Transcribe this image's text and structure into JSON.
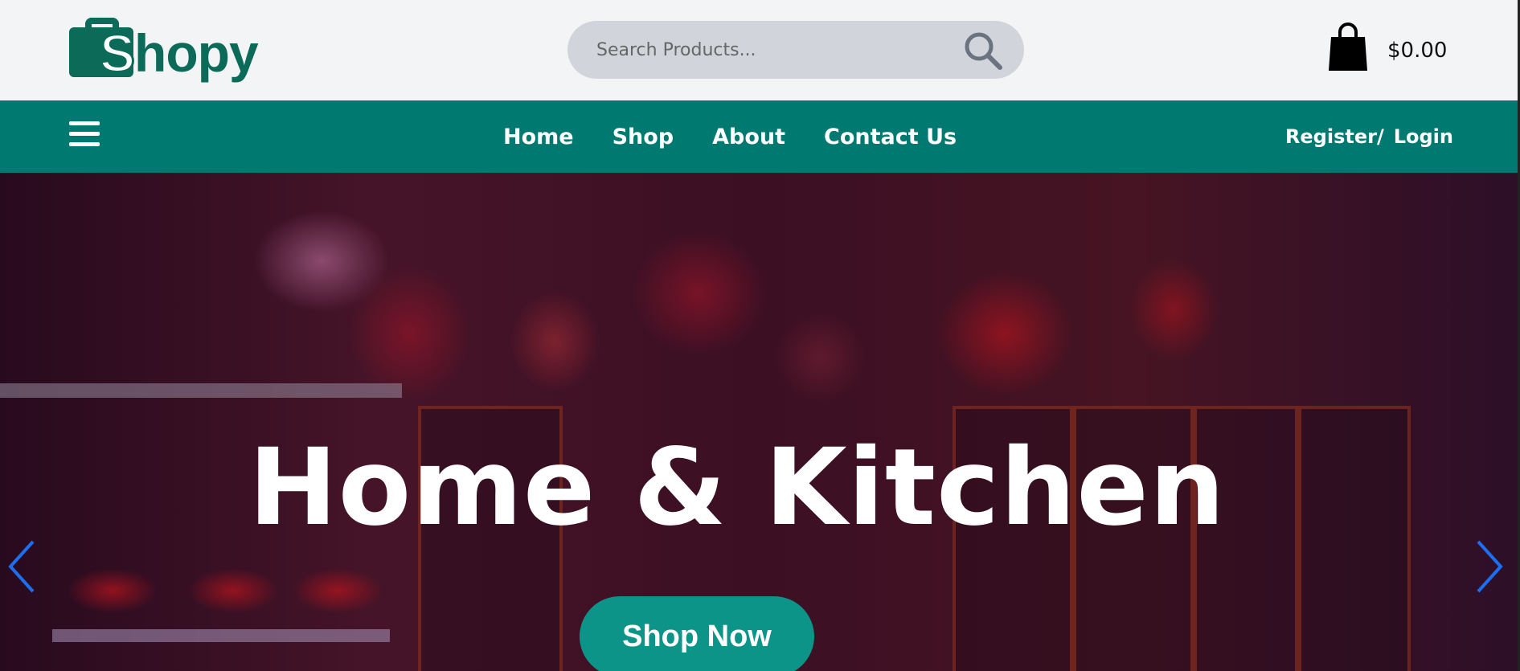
{
  "header": {
    "logo_text": "Shopy",
    "search_placeholder": "Search Products...",
    "search_icon": "search-icon",
    "cart_icon": "shopping-bag-icon",
    "cart_total": "$0.00"
  },
  "nav": {
    "menu_icon": "hamburger-icon",
    "links": [
      {
        "label": "Home"
      },
      {
        "label": "Shop"
      },
      {
        "label": "About"
      },
      {
        "label": "Contact Us"
      }
    ],
    "register_label": "Register/",
    "login_label": "Login"
  },
  "hero": {
    "title": "Home & Kitchen",
    "cta_label": "Shop Now",
    "prev_icon": "chevron-left-icon",
    "next_icon": "chevron-right-icon"
  },
  "colors": {
    "brand": "#0b6b58",
    "navbar": "#007a70",
    "cta": "#0d9488",
    "arrow": "#1d6ff2"
  }
}
